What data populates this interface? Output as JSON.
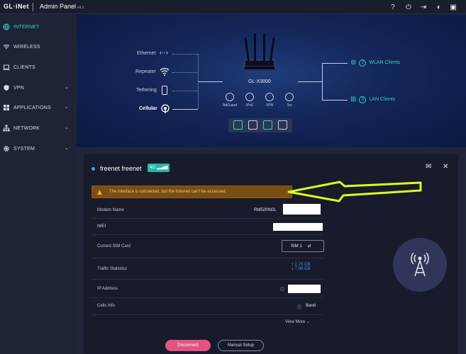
{
  "topbar": {
    "logo": "GL·iNet",
    "title": "Admin Panel",
    "version": "v4.0"
  },
  "sidebar": {
    "items": [
      {
        "label": "INTERNET",
        "active": true,
        "icon": "globe-icon"
      },
      {
        "label": "WIRELESS",
        "active": false,
        "icon": "wifi-icon"
      },
      {
        "label": "CLIENTS",
        "active": false,
        "icon": "laptop-icon"
      },
      {
        "label": "VPN",
        "active": false,
        "icon": "shield-icon",
        "chevron": true
      },
      {
        "label": "APPLICATIONS",
        "active": false,
        "icon": "grid-icon",
        "chevron": true
      },
      {
        "label": "NETWORK",
        "active": false,
        "icon": "network-icon",
        "chevron": true
      },
      {
        "label": "SYSTEM",
        "active": false,
        "icon": "gear-icon",
        "chevron": true
      }
    ]
  },
  "hero": {
    "ethernet": "Ethernet",
    "repeater": "Repeater",
    "tethering": "Tethering",
    "cellular": "Cellular",
    "router_name": "GL-X3000",
    "services": [
      "AdGuard",
      "IPv6",
      "VPN",
      "Tor"
    ],
    "wlan": {
      "count": "2",
      "label": "WLAN Clients"
    },
    "lan": {
      "count": "3",
      "label": "LAN Clients"
    }
  },
  "card": {
    "title": "freenet freenet",
    "badge": "4G",
    "warning": "The interface is connected, but the Internet can't be accessed.",
    "modem_label": "Modem Name",
    "modem_value": "RM520NGL",
    "imei_label": "IMEI",
    "sim_label": "Current SIM Card",
    "sim_value": "SIM 1",
    "traffic_label": "Traffic Statistics",
    "traffic_up": "2.76 GB",
    "traffic_down": "7.99 GB",
    "ip_label": "IP Address",
    "cells_label": "Cells Info",
    "cells_value": "Band",
    "view_more": "View More",
    "disconnect": "Disconnect",
    "manual": "Manual Setup"
  },
  "colors": {
    "accent": "#3bd0c2",
    "warning_bg": "#7b4e13",
    "annotation_arrow": "#d9ff1c",
    "disconnect": "#e2547f"
  }
}
